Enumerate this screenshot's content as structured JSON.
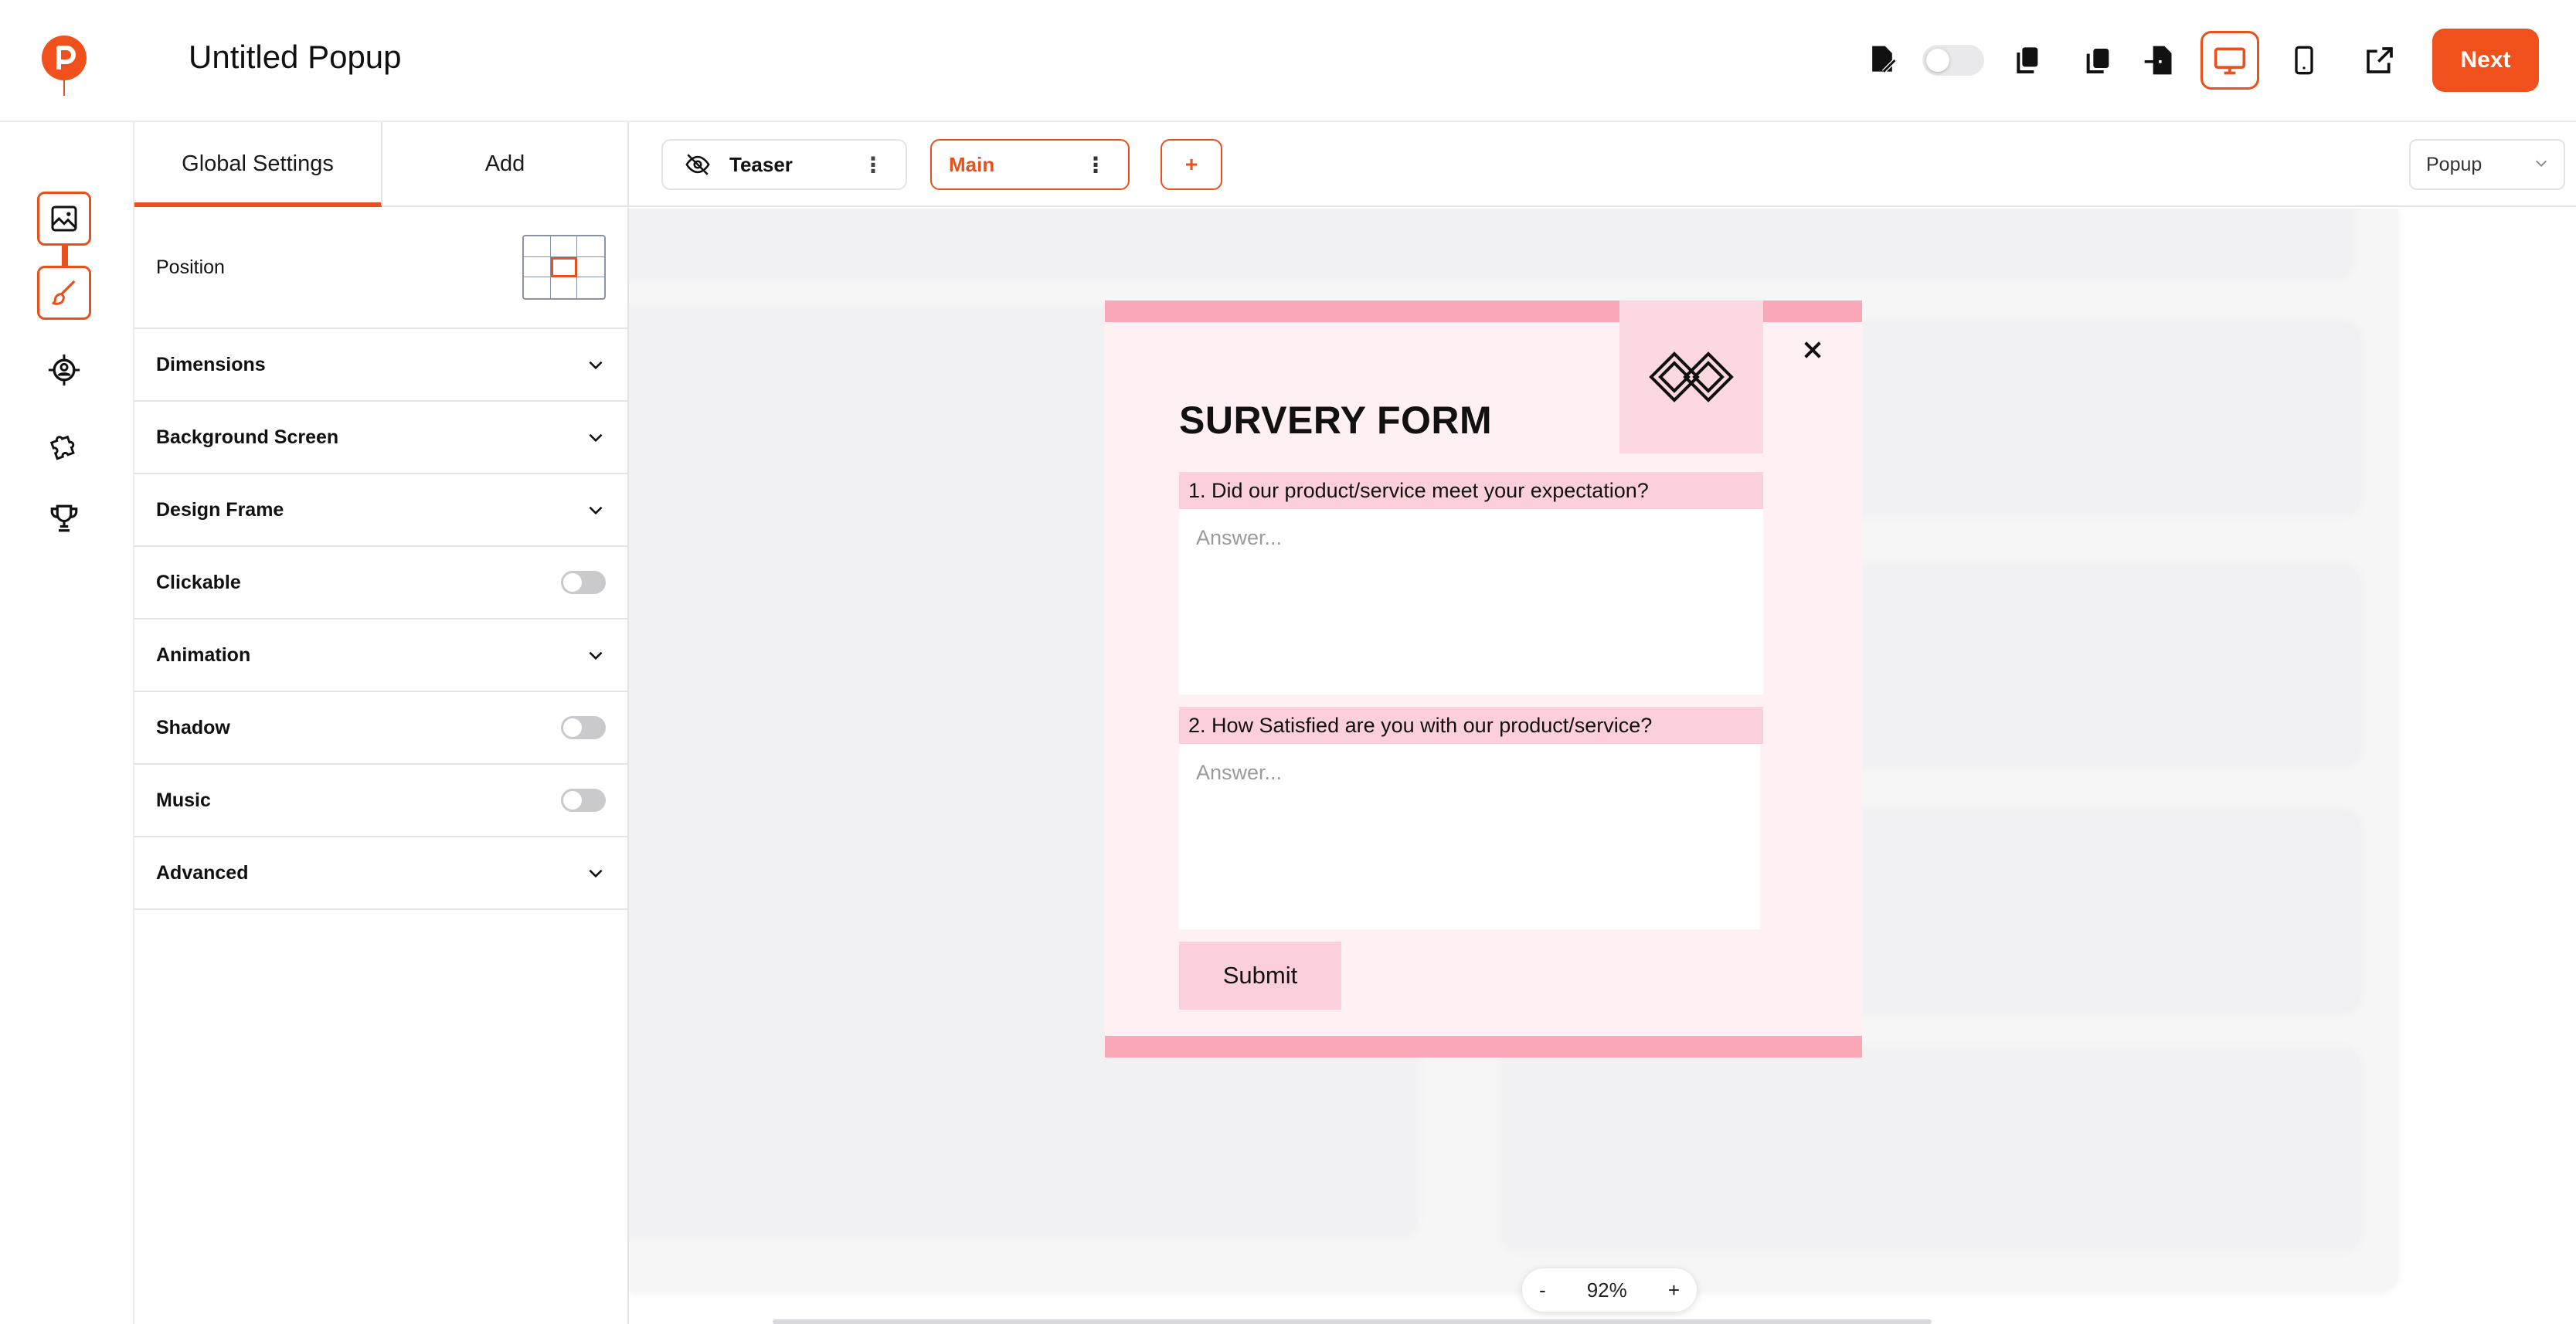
{
  "app": {
    "title": "Untitled Popup"
  },
  "topbar": {
    "icons": [
      "edit-document-icon",
      "toggle-switch",
      "copy-icon",
      "duplicate-icon",
      "import-icon",
      "desktop-icon",
      "mobile-icon",
      "external-link-icon"
    ],
    "next_label": "Next"
  },
  "rail": {
    "items": [
      "image-icon",
      "brush-icon",
      "target-icon",
      "puzzle-icon",
      "trophy-icon"
    ]
  },
  "panel": {
    "tabs": [
      {
        "label": "Global Settings",
        "active": true
      },
      {
        "label": "Add",
        "active": false
      }
    ],
    "position_label": "Position",
    "rows": [
      {
        "label": "Dimensions",
        "control": "chevron"
      },
      {
        "label": "Background Screen",
        "control": "chevron"
      },
      {
        "label": "Design Frame",
        "control": "chevron"
      },
      {
        "label": "Clickable",
        "control": "toggle"
      },
      {
        "label": "Animation",
        "control": "chevron"
      },
      {
        "label": "Shadow",
        "control": "toggle"
      },
      {
        "label": "Music",
        "control": "toggle"
      },
      {
        "label": "Advanced",
        "control": "chevron"
      }
    ]
  },
  "canvas_head": {
    "pages": [
      {
        "label": "Teaser"
      },
      {
        "label": "Main"
      }
    ],
    "add_label": "+",
    "select_value": "Popup"
  },
  "popup": {
    "title": "SURVERY FORM",
    "q1": "1. Did our product/service meet your expectation?",
    "q2": "2. How Satisfied are you with our product/service?",
    "placeholder": "Answer...",
    "submit": "Submit"
  },
  "zoom": {
    "minus": "-",
    "value": "92%",
    "plus": "+"
  },
  "colors": {
    "accent": "#e8501e",
    "pink_band": "#f9a8b8",
    "pink_bg": "#fff0f3",
    "pink_label": "#fbd0da"
  }
}
